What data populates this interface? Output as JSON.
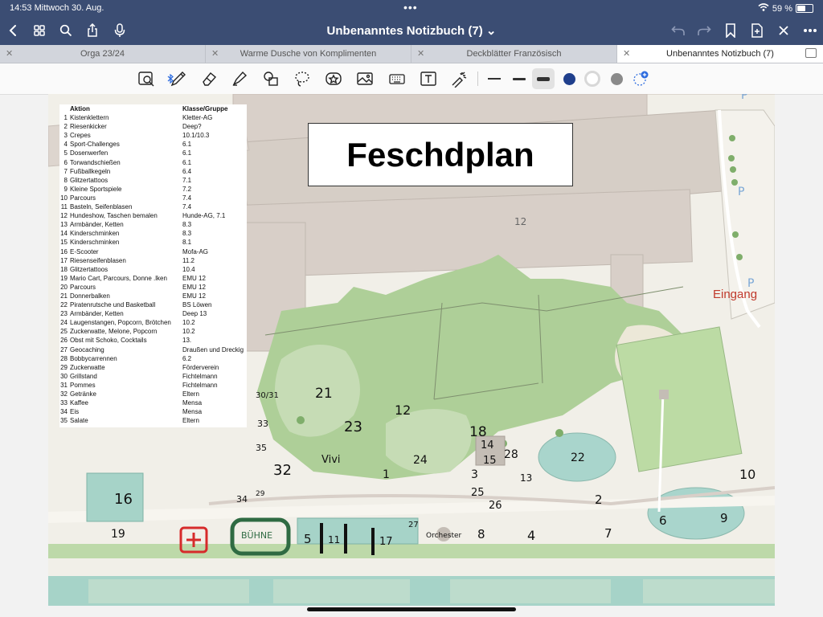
{
  "status_bar": {
    "time_date": "14:53  Mittwoch 30. Aug.",
    "battery": "59 %"
  },
  "top_bar": {
    "notebook_title": "Unbenanntes Notizbuch (7)",
    "title_chevron": "⌄"
  },
  "tabs": [
    {
      "label": "Orga 23/24"
    },
    {
      "label": "Warme Dusche von Komplimenten"
    },
    {
      "label": "Deckblätter Französisch"
    },
    {
      "label": "Unbenanntes Notizbuch (7)",
      "active": true
    }
  ],
  "toolbar": {
    "tools": [
      "lasso-zoom",
      "pen",
      "eraser",
      "highlighter",
      "shapes",
      "lasso",
      "stickers",
      "image",
      "keyboard",
      "text",
      "laser-pointer"
    ],
    "stroke_sizes": [
      "thin",
      "medium",
      "thick"
    ],
    "colors": [
      "#1f3f8c",
      "#ffffff",
      "#8a8a8a"
    ]
  },
  "page": {
    "title": "Feschdplan",
    "entrance_label": "Eingang",
    "legend": {
      "headers": {
        "action": "Aktion",
        "group": "Klasse/Gruppe"
      },
      "rows": [
        {
          "n": "1",
          "a": "Kistenklettern",
          "g": "Kletter-AG"
        },
        {
          "n": "2",
          "a": "Riesenkicker",
          "g": "Deep?"
        },
        {
          "n": "3",
          "a": "Crepes",
          "g": "10.1/10.3"
        },
        {
          "n": "4",
          "a": "Sport-Challenges",
          "g": "6.1"
        },
        {
          "n": "5",
          "a": "Dosenwerfen",
          "g": "6.1"
        },
        {
          "n": "6",
          "a": "Torwandschießen",
          "g": "6.1"
        },
        {
          "n": "7",
          "a": "Fußballkegeln",
          "g": "6.4"
        },
        {
          "n": "8",
          "a": "Glitzertattoos",
          "g": "7.1"
        },
        {
          "n": "9",
          "a": "Kleine Sportspiele",
          "g": "7.2"
        },
        {
          "n": "10",
          "a": "Parcours",
          "g": "7.4"
        },
        {
          "n": "11",
          "a": "Basteln, Seifenblasen",
          "g": "7.4"
        },
        {
          "n": "12",
          "a": "Hundeshow, Taschen bemalen",
          "g": "Hunde-AG, 7.1"
        },
        {
          "n": "13",
          "a": "Armbänder, Ketten",
          "g": "8.3"
        },
        {
          "n": "14",
          "a": "Kinderschminken",
          "g": "8.3"
        },
        {
          "n": "15",
          "a": "Kinderschminken",
          "g": "8.1"
        },
        {
          "n": "16",
          "a": "E-Scooter",
          "g": "Mofa-AG"
        },
        {
          "n": "17",
          "a": "Riesenseifenblasen",
          "g": "11.2"
        },
        {
          "n": "18",
          "a": "Glitzertattoos",
          "g": "10.4"
        },
        {
          "n": "19",
          "a": "Mario Cart, Parcours, Donne   .lken",
          "g": "EMU 12"
        },
        {
          "n": "20",
          "a": "Parcours",
          "g": "EMU 12"
        },
        {
          "n": "21",
          "a": "Donnerbalken",
          "g": "EMU 12"
        },
        {
          "n": "22",
          "a": "Piratenrutsche und Basketball",
          "g": "BS Löwen"
        },
        {
          "n": "23",
          "a": "Armbänder, Ketten",
          "g": "Deep 13"
        },
        {
          "n": "24",
          "a": "Laugenstangen, Popcorn, Brötchen",
          "g": "10.2"
        },
        {
          "n": "25",
          "a": "Zuckerwatte, Melone, Popcorn",
          "g": "10.2"
        },
        {
          "n": "26",
          "a": "Obst mit Schoko, Cocktails",
          "g": "13."
        },
        {
          "n": "27",
          "a": "Geocaching",
          "g": "Draußen und Dreckig"
        },
        {
          "n": "28",
          "a": "Bobbycarrennen",
          "g": "6.2"
        },
        {
          "n": "29",
          "a": "Zuckerwatte",
          "g": "Förderverein"
        },
        {
          "n": "30",
          "a": "Grillstand",
          "g": "Fichtelmann"
        },
        {
          "n": "31",
          "a": "Pommes",
          "g": "Fichtelmann"
        },
        {
          "n": "32",
          "a": "Getränke",
          "g": "Eltern"
        },
        {
          "n": "33",
          "a": "Kaffee",
          "g": "Mensa"
        },
        {
          "n": "34",
          "a": "Eis",
          "g": "Mensa"
        },
        {
          "n": "35",
          "a": "Salate",
          "g": "Eltern"
        }
      ]
    },
    "handwritten": {
      "stage": "BÜHNE",
      "first_aid": "+",
      "orchester": "Orchester",
      "vivi": "Vivi",
      "map_12": "12",
      "map_labels": [
        "21",
        "12",
        "30/31",
        "33",
        "23",
        "35",
        "24",
        "18",
        "14",
        "15",
        "28",
        "22",
        "32",
        "1",
        "3",
        "13",
        "10",
        "16",
        "29",
        "34",
        "25",
        "26",
        "2",
        "6",
        "9",
        "27",
        "19",
        "5",
        "11",
        "17",
        "8",
        "4",
        "7"
      ]
    }
  }
}
